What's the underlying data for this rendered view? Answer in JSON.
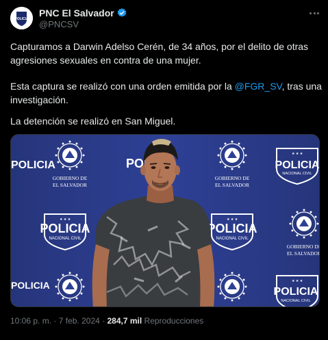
{
  "author": {
    "display_name": "PNC El Salvador",
    "handle": "@PNCSV",
    "avatar_text": "POLICIA"
  },
  "tweet": {
    "paragraph1": "Capturamos a Darwin Adelso Cerén, de 34 años, por el delito de otras agresiones sexuales en contra de una mujer.",
    "paragraph2_before": "Esta captura se realizó con una orden emitida por la ",
    "mention": "@FGR_SV",
    "paragraph2_after": ", tras una investigación.",
    "paragraph3": "La detención se realizó en San Miguel."
  },
  "media": {
    "backdrop_text": {
      "policia": "POLICIA",
      "nacional_civil": "NACIONAL CIVIL",
      "gobierno": "GOBIERNO DE",
      "el_salvador": "EL SALVADOR"
    }
  },
  "footer": {
    "time": "10:06 p. m.",
    "separator": "·",
    "date": "7 feb. 2024",
    "views_count": "284,7 mil",
    "views_label": "Reproducciones"
  },
  "colors": {
    "background": "#000000",
    "text": "#e7e9ea",
    "muted": "#71767b",
    "link": "#1d9bf0",
    "verified": "#1d9bf0",
    "backdrop": "#2a3a86"
  }
}
